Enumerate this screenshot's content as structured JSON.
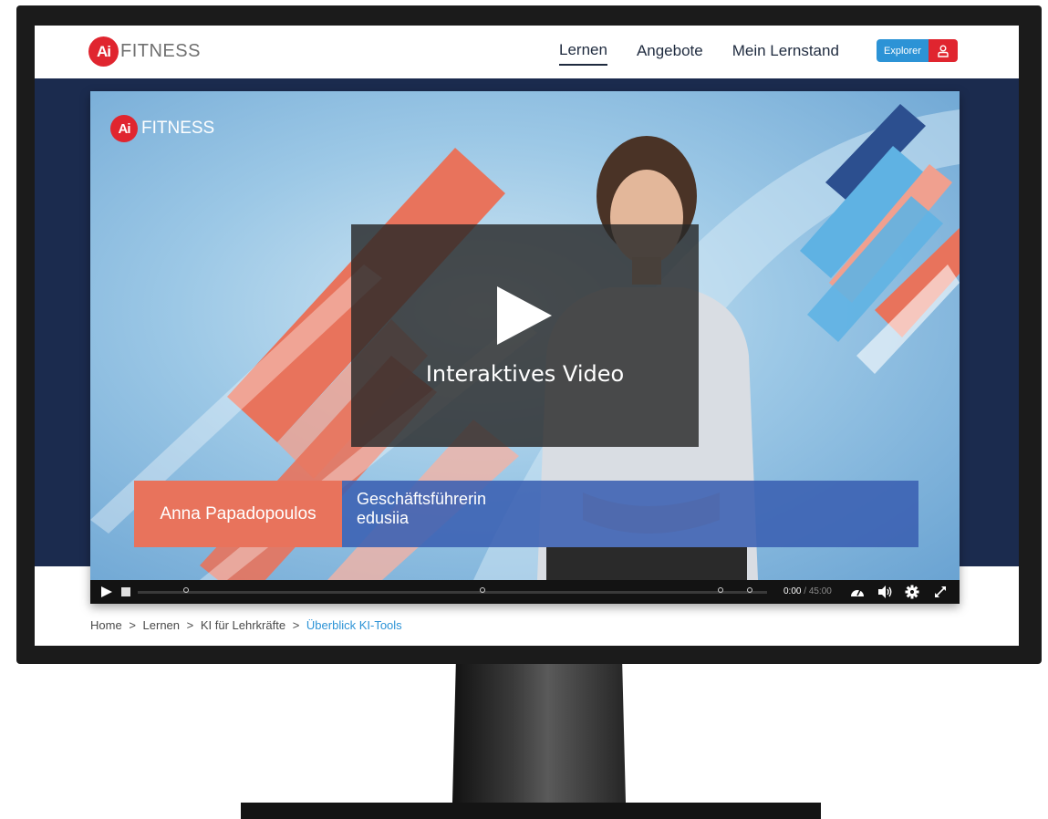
{
  "logo": {
    "mark": "Ai",
    "text": "FITNESS"
  },
  "nav": {
    "items": [
      {
        "label": "Lernen",
        "active": true
      },
      {
        "label": "Angebote",
        "active": false
      },
      {
        "label": "Mein Lernstand",
        "active": false
      }
    ],
    "explorer_label": "Explorer"
  },
  "video": {
    "logo_mark": "Ai",
    "logo_text": "FITNESS",
    "overlay_title": "Interaktives Video",
    "speaker_name": "Anna Papadopoulos",
    "speaker_role_line1": "Geschäftsführerin",
    "speaker_role_line2": "edusiia",
    "time_current": "0:00",
    "time_separator": "/",
    "time_total": "45:00",
    "progress": 0
  },
  "breadcrumb": {
    "items": [
      "Home",
      "Lernen",
      "KI für Lehrkräfte"
    ],
    "current": "Überblick KI-Tools",
    "separator": ">"
  },
  "colors": {
    "brand_red": "#e0252f",
    "accent_blue": "#2c93d6",
    "navy_band": "#1b2b4e",
    "lower_third_orange": "#e8735c",
    "lower_third_blue": "#3a60b2"
  },
  "icons": [
    "play-icon",
    "chapter-icon",
    "speed-icon",
    "volume-icon",
    "settings-icon",
    "fullscreen-icon",
    "user-icon"
  ]
}
